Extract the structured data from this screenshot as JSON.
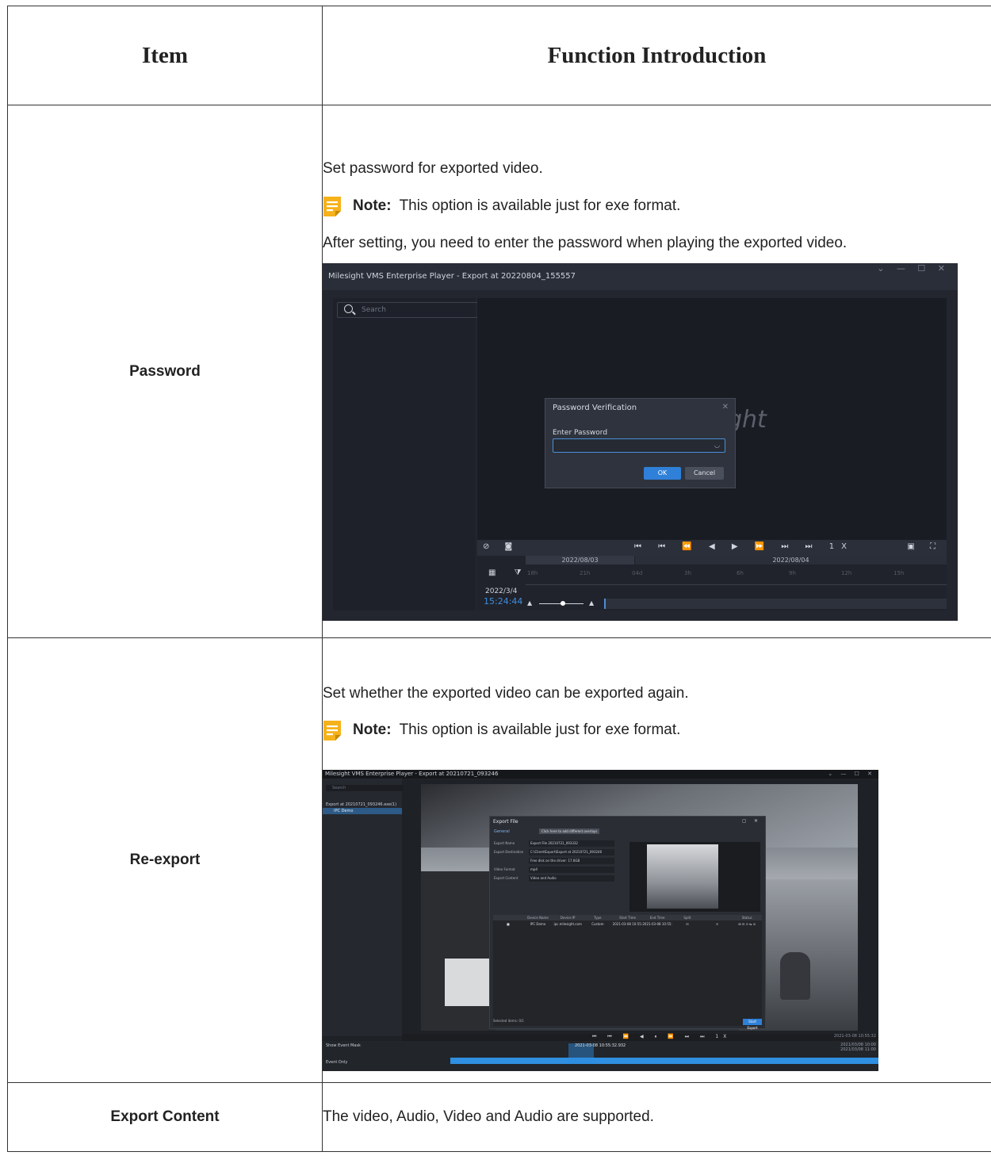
{
  "table": {
    "headers": {
      "item": "Item",
      "function": "Function Introduction"
    },
    "rows": {
      "password": {
        "item": "Password",
        "desc": "Set password for exported video.",
        "note_label": "Note:",
        "note_text": "This option is available just for exe format.",
        "after": "After setting, you need to enter the password when playing the exported video."
      },
      "reexport": {
        "item": "Re-export",
        "desc": "Set whether the exported video can be exported again.",
        "note_label": "Note:",
        "note_text": "This option is available just for exe format."
      },
      "content": {
        "item": "Export Content",
        "desc": "The video, Audio, Video and Audio are supported."
      }
    }
  },
  "shot1": {
    "title": "Milesight VMS Enterprise Player - Export at 20220804_155557",
    "window_controls": "⌄ — ☐ ✕",
    "search_placeholder": "Search",
    "logo_fragment": "ght",
    "dialog": {
      "title": "Password Verification",
      "close": "✕",
      "label": "Enter Password",
      "eye_icon": "◡",
      "ok": "OK",
      "cancel": "Cancel"
    },
    "controls": {
      "left_icons": "⊘ ◙",
      "playback_icons": "⏮ ⏮ ⏪ ◀ ▶ ⏩ ⏭ ⏭",
      "speed": "1X",
      "right_icons": "▣ ⛶"
    },
    "timeline": {
      "date_left": "2022/08/03",
      "date_right": "2022/08/04",
      "icons": "▦ ⧩",
      "date": "2022/3/4",
      "time": "15:24:44",
      "ticks": [
        "18h",
        "21h",
        "04d",
        "3h",
        "6h",
        "9h",
        "12h",
        "15h"
      ],
      "zoom_min_icon": "▲",
      "zoom_max_icon": "▲"
    }
  },
  "shot2": {
    "title": "Milesight VMS Enterprise Player - Export at 20210721_093246",
    "window_controls": "⌄ — ☐ ✕",
    "search_placeholder": "Search",
    "tree_root": "Export at 20210721_093246.exe(1)",
    "tree_child": "IPC Demo",
    "dialog": {
      "title": "Export File",
      "controls": "◻ ✕",
      "tab": "General",
      "tooltip": "Click here to add different overlays",
      "fields": [
        {
          "label": "Export Name",
          "value": "Export File 20210721_093332"
        },
        {
          "label": "Export Destination",
          "value": "C:\\Client\\Export\\Export at 20210721_093246"
        },
        {
          "label": "",
          "value": "Free disk on the driver: 17.6GB"
        },
        {
          "label": "Video Format",
          "value": "mp4"
        },
        {
          "label": "Export Content",
          "value": "Video and Audio"
        }
      ],
      "table_headers": [
        "",
        "Device Name",
        "Device IP",
        "Type",
        "Start Time",
        "End Time",
        "Split",
        "",
        "Status"
      ],
      "table_row": [
        "■",
        "IPC Demo",
        "ipc.milesight.com",
        "Custom",
        "2021-03-08 10:55:03",
        "2021-03-08 10:55:29",
        "⊟",
        "✕",
        "⊞ ⊟ ⊙ ⇆ ⊘"
      ],
      "selected": "Selected items: 0/1",
      "start": "Start Export"
    },
    "controls": {
      "buttons": "⏮ ⏮ ⏪ ◀ ⏸ ⏩ ⏭ ⏭ 1X",
      "datetime": "2021-03-08 10:55:32"
    },
    "timeline": {
      "show_mask": "Show Event Mask",
      "event_only": "Event Only",
      "stamp": "2021-03-08 10:55:32.932",
      "date_a": "2021/03/08 10:00",
      "date_b": "2021/03/08 11:00"
    }
  }
}
